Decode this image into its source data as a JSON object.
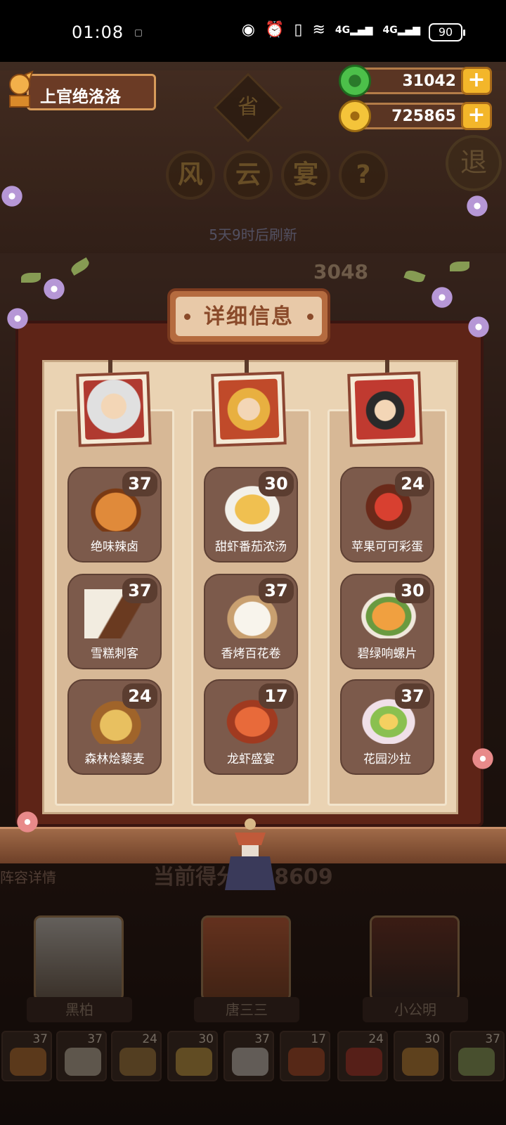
{
  "status_bar": {
    "time": "01:08",
    "battery": "90",
    "net1": "4G",
    "net2": "4G"
  },
  "player": {
    "name": "上官绝洛洛"
  },
  "currencies": [
    {
      "name": "jade",
      "value": "31042",
      "color": "#3fb34a"
    },
    {
      "name": "coin",
      "value": "725865",
      "color": "#e9b42a"
    }
  ],
  "event": {
    "badge": "省",
    "title_chars": [
      "风",
      "云",
      "宴"
    ],
    "help": "?",
    "exit": "退",
    "refresh_text": "5天9时后刷新",
    "score_partial": "3048"
  },
  "modal": {
    "title": "详细信息",
    "columns": [
      {
        "hero": "黑柏",
        "dishes": [
          {
            "name": "绝味辣卤",
            "count": "37",
            "color": "#e08a3a"
          },
          {
            "name": "雪糕刺客",
            "count": "37",
            "color": "#e8dcc6"
          },
          {
            "name": "森林烩藜麦",
            "count": "24",
            "color": "#c69a4a"
          }
        ]
      },
      {
        "hero": "唐三三",
        "dishes": [
          {
            "name": "甜虾番茄浓汤",
            "count": "30",
            "color": "#f0c050"
          },
          {
            "name": "香烤百花卷",
            "count": "37",
            "color": "#f4efe4"
          },
          {
            "name": "龙虾盛宴",
            "count": "17",
            "color": "#d0582e"
          }
        ]
      },
      {
        "hero": "小公明",
        "dishes": [
          {
            "name": "苹果可可彩蛋",
            "count": "24",
            "color": "#d04030"
          },
          {
            "name": "碧绿响螺片",
            "count": "30",
            "color": "#e8a040"
          },
          {
            "name": "花园沙拉",
            "count": "37",
            "color": "#a8c870"
          }
        ]
      }
    ]
  },
  "bottom": {
    "lineup_label": "阵容详情",
    "current_score": "当前得分 238609",
    "heroes": [
      "黑柏",
      "唐三三",
      "小公明"
    ],
    "mini_counts": [
      "37",
      "37",
      "24",
      "30",
      "37",
      "17",
      "24",
      "30",
      "37"
    ]
  }
}
